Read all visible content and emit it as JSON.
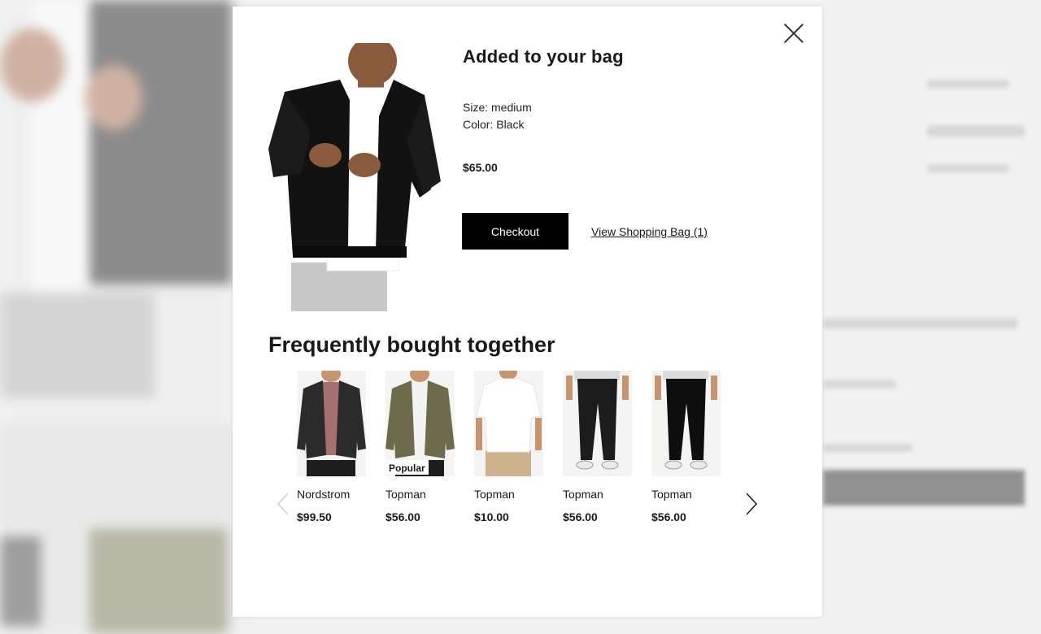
{
  "modal": {
    "title": "Added to your bag",
    "size_line": "Size: medium",
    "color_line": "Color: Black",
    "price": "$65.00",
    "checkout_label": "Checkout",
    "view_bag_label": "View Shopping Bag (1)"
  },
  "recommendations": {
    "title": "Frequently bought together",
    "items": [
      {
        "brand": "Nordstrom",
        "price": "$99.50",
        "badge": "",
        "garment": "jacket",
        "shirt_color": "#a86f70",
        "jacket_color": "#2b2b2b"
      },
      {
        "brand": "Topman",
        "price": "$56.00",
        "badge": "Popular",
        "garment": "shirt-jacket",
        "shirt_color": "#f3f3f3",
        "jacket_color": "#6e6a4c"
      },
      {
        "brand": "Topman",
        "price": "$10.00",
        "badge": "",
        "garment": "tee",
        "shirt_color": "#ffffff",
        "jacket_color": ""
      },
      {
        "brand": "Topman",
        "price": "$56.00",
        "badge": "",
        "garment": "jeans",
        "shirt_color": "",
        "jacket_color": "#1c1c1c"
      },
      {
        "brand": "Topman",
        "price": "$56.00",
        "badge": "",
        "garment": "jeans",
        "shirt_color": "",
        "jacket_color": "#0e0e0e"
      }
    ]
  },
  "colors": {
    "button_bg": "#000000",
    "text": "#1a1a1a"
  }
}
